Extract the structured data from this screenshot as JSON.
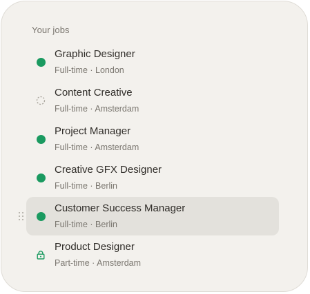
{
  "section_title": "Your jobs",
  "colors": {
    "active": "#1a9a60",
    "pending": "#a8a49c",
    "selected_bg": "#e3e1dc",
    "card_bg": "#f3f1ed"
  },
  "jobs": [
    {
      "title": "Graphic Designer",
      "type": "Full-time",
      "location": "London",
      "meta": "Full-time · London",
      "status": "active",
      "status_icon": "active-dot-icon",
      "selected": false
    },
    {
      "title": "Content Creative",
      "type": "Full-time",
      "location": "Amsterdam",
      "meta": "Full-time · Amsterdam",
      "status": "draft",
      "status_icon": "dashed-circle-icon",
      "selected": false
    },
    {
      "title": "Project Manager",
      "type": "Full-time",
      "location": "Amsterdam",
      "meta": "Full-time · Amsterdam",
      "status": "active",
      "status_icon": "active-dot-icon",
      "selected": false
    },
    {
      "title": "Creative GFX Designer",
      "type": "Full-time",
      "location": "Berlin",
      "meta": "Full-time · Berlin",
      "status": "active",
      "status_icon": "active-dot-icon",
      "selected": false
    },
    {
      "title": "Customer Success Manager",
      "type": "Full-time",
      "location": "Berlin",
      "meta": "Full-time · Berlin",
      "status": "active",
      "status_icon": "active-dot-icon",
      "selected": true
    },
    {
      "title": "Product Designer",
      "type": "Part-time",
      "location": "Amsterdam",
      "meta": "Part-time · Amsterdam",
      "status": "locked",
      "status_icon": "lock-icon",
      "selected": false
    }
  ]
}
